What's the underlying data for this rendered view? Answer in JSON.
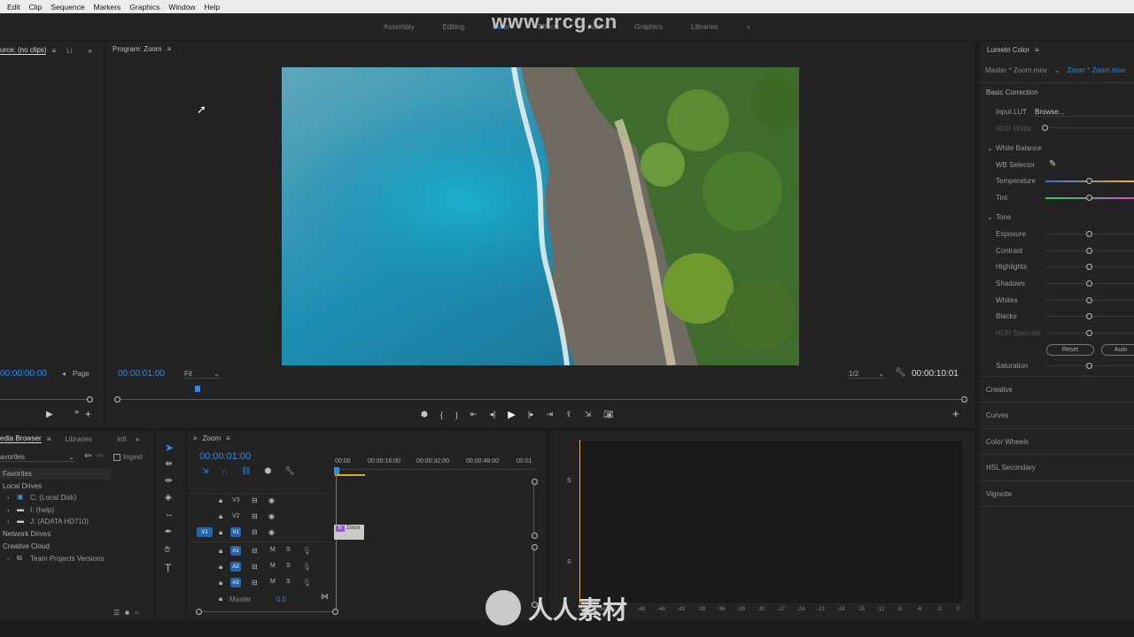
{
  "menu": [
    "Edit",
    "Clip",
    "Sequence",
    "Markers",
    "Graphics",
    "Window",
    "Help"
  ],
  "workspaces": [
    "Assembly",
    "Editing",
    "Color",
    "Effects",
    "Audio",
    "Graphics",
    "Libraries"
  ],
  "active_workspace": "Color",
  "watermark": "www.rrcg.cn",
  "watermark_bottom": "人人素材",
  "source": {
    "tab": "urce: (no clips)",
    "tab2": "Li",
    "timecode": "00:00:00:00",
    "page": "Page"
  },
  "program": {
    "tab": "Program: Zoom",
    "timecode": "00:00:01:00",
    "fit": "Fit",
    "ratio": "1/2",
    "duration": "00:00:10:01"
  },
  "lumetri": {
    "title": "Lumetri Color",
    "master": "Master * Zoom.mov",
    "clip": "Zoom * Zoom.mov",
    "basic": "Basic Correction",
    "input_lut_label": "Input LUT",
    "input_lut_value": "Browse...",
    "hdr_white": "HDR White",
    "white_balance": "White Balance",
    "wb_selector": "WB Selector",
    "temperature": "Temperature",
    "tint": "Tint",
    "tone": "Tone",
    "exposure": "Exposure",
    "contrast": "Contrast",
    "highlights": "Highlights",
    "shadows": "Shadows",
    "whites": "Whites",
    "blacks": "Blacks",
    "hdr_specular": "HDR Specular",
    "reset": "Reset",
    "auto": "Auto",
    "saturation": "Saturation",
    "creative": "Creative",
    "curves": "Curves",
    "color_wheels": "Color Wheels",
    "hsl": "HSL Secondary",
    "vignette": "Vignette"
  },
  "media_browser": {
    "tab": "edia Browser",
    "tab2": "Libraries",
    "tab3": "Infi",
    "dropdown": "avorites",
    "ingest": "Ingest",
    "favorites": "Favorites",
    "local_drives": "Local Drives",
    "drives": [
      "C: (Local Disk)",
      "I: (help)",
      "J: (ADATA HD710)"
    ],
    "network": "Network Drives",
    "cloud": "Creative Cloud",
    "team": "Team Projects Versions"
  },
  "timeline": {
    "tab": "Zoom",
    "timecode": "00:00:01:00",
    "ruler": [
      "00:00",
      "00:00:16:00",
      "00:00:32:00",
      "00:00:48:00",
      "00:01"
    ],
    "video_tracks": [
      "V3",
      "V2",
      "V1"
    ],
    "audio_tracks": [
      "A1",
      "A2",
      "A3"
    ],
    "source_patch": "V1",
    "master": "Master",
    "master_value": "0.0",
    "clip_label": "Zoom"
  },
  "meter": {
    "labels": [
      "S",
      "S"
    ],
    "scale": [
      "-57",
      "-54",
      "-51",
      "-48",
      "-45",
      "-42",
      "-39",
      "-36",
      "-33",
      "-30",
      "-27",
      "-24",
      "-21",
      "-18",
      "-15",
      "-12",
      "-9",
      "-6",
      "-3",
      "0"
    ]
  },
  "colors": {
    "accent": "#2d8ceb",
    "panel": "#232323",
    "bg": "#1d1d1d",
    "track_blue": "#2366a9"
  }
}
